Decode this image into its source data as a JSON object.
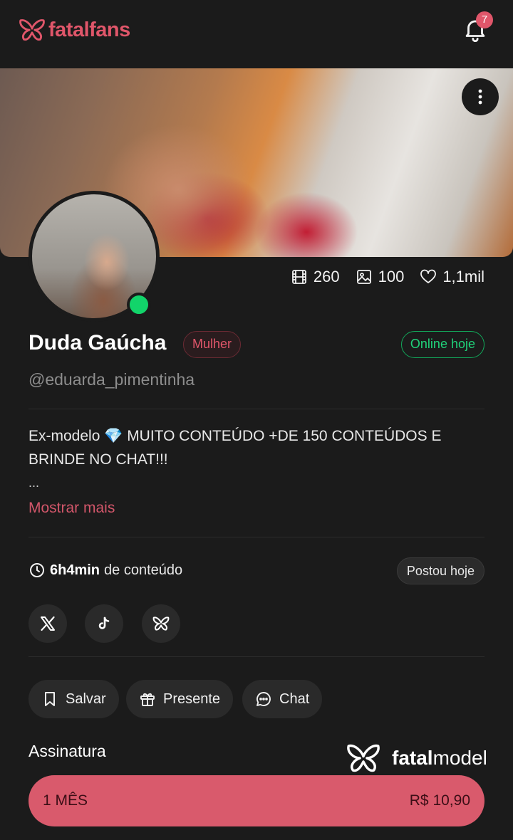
{
  "header": {
    "logo_text": "fatalfans",
    "notification_count": "7"
  },
  "profile": {
    "name": "Duda Gaúcha",
    "gender_tag": "Mulher",
    "status_tag": "Online hoje",
    "handle": "@eduarda_pimentinha",
    "stats": {
      "videos": "260",
      "photos": "100",
      "likes": "1,1mil"
    }
  },
  "bio": {
    "text": "Ex-modelo 💎 MUITO CONTEÚDO +DE 150 CONTEÚDOS E BRINDE NO CHAT!!!",
    "ellipsis": "...",
    "show_more": "Mostrar mais"
  },
  "content_info": {
    "duration": "6h4min",
    "duration_suffix": "de conteúdo",
    "posted_tag": "Postou hoje"
  },
  "social_links": [
    "x-icon",
    "tiktok-icon",
    "fatalmodel-icon"
  ],
  "actions": {
    "save_label": "Salvar",
    "gift_label": "Presente",
    "chat_label": "Chat"
  },
  "subscription": {
    "title": "Assinatura",
    "plan_label": "1 MÊS",
    "plan_price": "R$ 10,90"
  },
  "watermark": {
    "brand_bold": "fatal",
    "brand_rest": "model"
  },
  "colors": {
    "background": "#1b1b1b",
    "accent": "#e0566a",
    "online_green": "#12d46a",
    "plan_button": "#d95a6c"
  }
}
